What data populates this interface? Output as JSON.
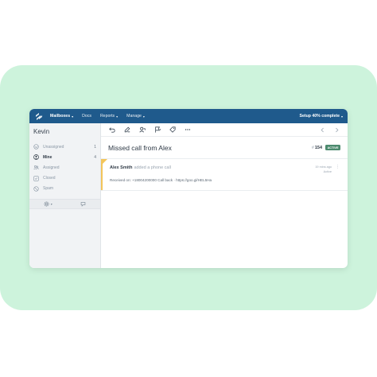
{
  "topnav": {
    "items": [
      {
        "label": "Mailboxes",
        "active": true,
        "dropdown": true
      },
      {
        "label": "Docs",
        "active": false,
        "dropdown": false
      },
      {
        "label": "Reports",
        "active": false,
        "dropdown": true
      },
      {
        "label": "Manage",
        "active": false,
        "dropdown": true
      }
    ],
    "setup_label": "Setup 40% complete"
  },
  "sidebar": {
    "user": "Kevin",
    "folders": [
      {
        "label": "Unassigned",
        "count": "1",
        "icon": "inbox-icon"
      },
      {
        "label": "Mine",
        "count": "4",
        "icon": "person-icon"
      },
      {
        "label": "Assigned",
        "count": "",
        "icon": "people-icon"
      },
      {
        "label": "Closed",
        "count": "",
        "icon": "check-box-icon"
      },
      {
        "label": "Spam",
        "count": "",
        "icon": "ban-icon"
      }
    ],
    "footer_icons": [
      "gear-icon",
      "new-conversation-icon"
    ]
  },
  "toolbar": {
    "icons": [
      "undo-icon",
      "note-icon",
      "assign-icon",
      "status-flag-icon",
      "tag-icon",
      "more-icon"
    ],
    "nav_icons": [
      "previous-icon",
      "next-icon"
    ]
  },
  "conversation": {
    "subject": "Missed call from Alex",
    "number_prefix": "#",
    "number": "154",
    "status": "ACTIVE",
    "status_color": "#4c8a6e"
  },
  "thread": {
    "author": "Alex Smith",
    "action": "added a phone call",
    "time": "19 mins ago",
    "state": "Active",
    "body": "Received on: +18004200000 Call back · https://goo.gl/HEL5Ha",
    "accent_color": "#f3c55a"
  },
  "colors": {
    "brand": "#1f5a8c",
    "background_card": "#cdf3dc"
  }
}
